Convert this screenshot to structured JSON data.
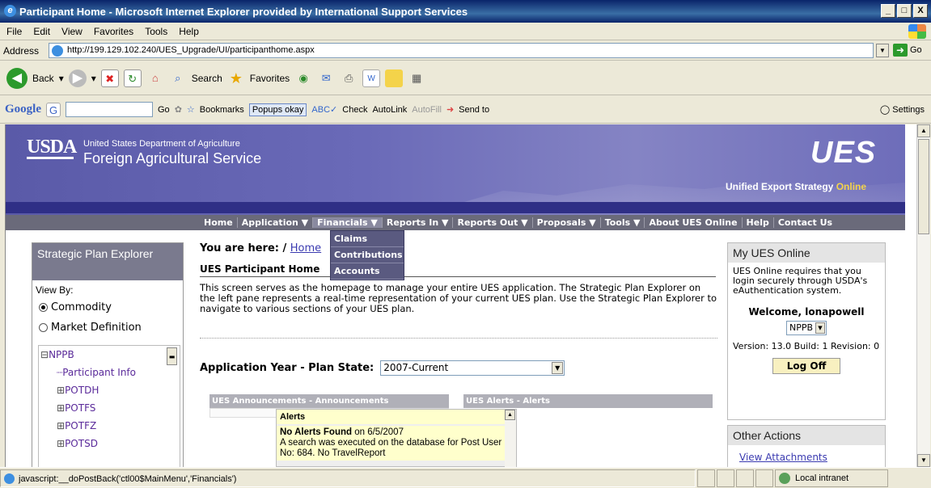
{
  "window": {
    "title": "Participant Home - Microsoft Internet Explorer provided by International Support Services",
    "buttons": [
      "_",
      "□",
      "X"
    ]
  },
  "menu": [
    "File",
    "Edit",
    "View",
    "Favorites",
    "Tools",
    "Help"
  ],
  "address": {
    "label": "Address",
    "url": "http://199.129.102.240/UES_Upgrade/UI/participanthome.aspx",
    "go_label": "Go"
  },
  "toolbar": {
    "back": "Back",
    "search": "Search",
    "favorites": "Favorites"
  },
  "googlebar": {
    "logo": "Google",
    "go": "Go",
    "bookmarks": "Bookmarks",
    "popups": "Popups okay",
    "check": "Check",
    "autolink": "AutoLink",
    "autofill": "AutoFill",
    "sendto": "Send to",
    "settings": "Settings"
  },
  "banner": {
    "usda": "USDA",
    "dept": "United States Department of Agriculture",
    "fas": "Foreign Agricultural Service",
    "ues_logo": "UES",
    "tagline_1": "Unified Export Strategy",
    "tagline_2": "Online"
  },
  "nav": [
    "Home",
    "Application ▼",
    "Financials ▼",
    "Reports In ▼",
    "Reports Out ▼",
    "Proposals ▼",
    "Tools ▼",
    "About UES Online",
    "Help",
    "Contact Us"
  ],
  "financials_menu": [
    "Claims",
    "Contributions",
    "Accounts"
  ],
  "left_pane": {
    "title": "Strategic Plan Explorer",
    "view_by": "View By:",
    "radio_commodity": "Commodity",
    "radio_market": "Market Definition",
    "tree": [
      "NPPB",
      "Participant Info",
      "POTDH",
      "POTFS",
      "POTFZ",
      "POTSD"
    ]
  },
  "main": {
    "you_are_here": "You are here: /",
    "home_link": "Home",
    "page_title": "UES Participant Home",
    "description": "This screen serves as the homepage to manage your entire UES application. The Strategic Plan Explorer on the left pane represents a real-time representation of your current UES plan. Use the Strategic Plan Explorer to navigate to various sections of your UES plan.",
    "app_year_label": "Application Year - Plan State:",
    "app_year_value": "2007-Current",
    "announcements_header": "UES Announcements - Announcements",
    "alerts_header": "UES Alerts - Alerts",
    "alerts_title": "Alerts",
    "no_alerts": "No Alerts Found",
    "no_alerts_date": "on 6/5/2007",
    "alert_text": "A search was executed on the database for Post User No: 684. No TravelReport"
  },
  "right_pane": {
    "title": "My UES Online",
    "login_text": "UES Online requires that you login securely through USDA's eAuthentication system.",
    "welcome": "Welcome, lonapowell",
    "org_value": "NPPB",
    "version": "Version: 13.0 Build: 1 Revision: 0",
    "logoff": "Log Off",
    "other_actions": "Other Actions",
    "view_attachments": "View Attachments"
  },
  "status": {
    "text": "javascript:__doPostBack('ctl00$MainMenu','Financials')",
    "zone": "Local intranet"
  }
}
